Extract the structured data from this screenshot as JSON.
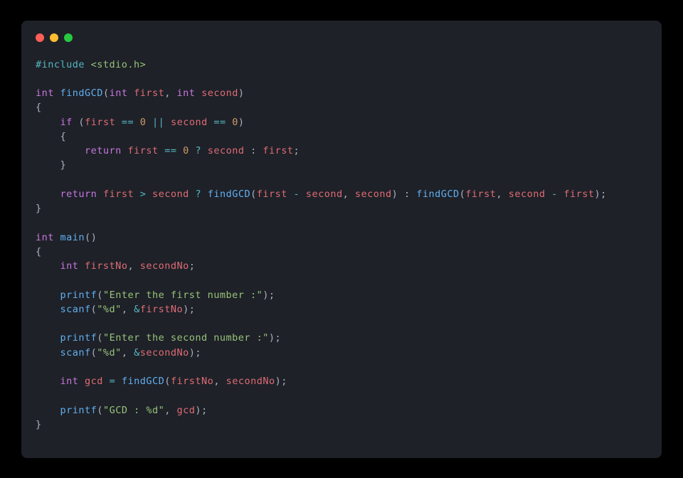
{
  "window": {
    "red": "close",
    "yellow": "minimize",
    "green": "zoom"
  },
  "code": {
    "include_kw": "#include",
    "include_path": " <stdio.h>",
    "int": "int",
    "findGCD": "findGCD",
    "main": "main",
    "first": "first",
    "second": "second",
    "firstNo": "firstNo",
    "secondNo": "secondNo",
    "gcd": "gcd",
    "if": "if",
    "return": "return",
    "printf": "printf",
    "scanf": "scanf",
    "zero": "0",
    "eq": "==",
    "or": "||",
    "gt": ">",
    "minus": "-",
    "assign": "=",
    "tern_q": "?",
    "tern_c": ":",
    "amp": "&",
    "lbrace": "{",
    "rbrace": "}",
    "lparen": "(",
    "rparen": ")",
    "comma": ",",
    "semi": ";",
    "str_enter_first": "\"Enter the first number :\"",
    "str_enter_second": "\"Enter the second number :\"",
    "str_pd": "\"%d\"",
    "str_gcd": "\"GCD : %d\""
  }
}
